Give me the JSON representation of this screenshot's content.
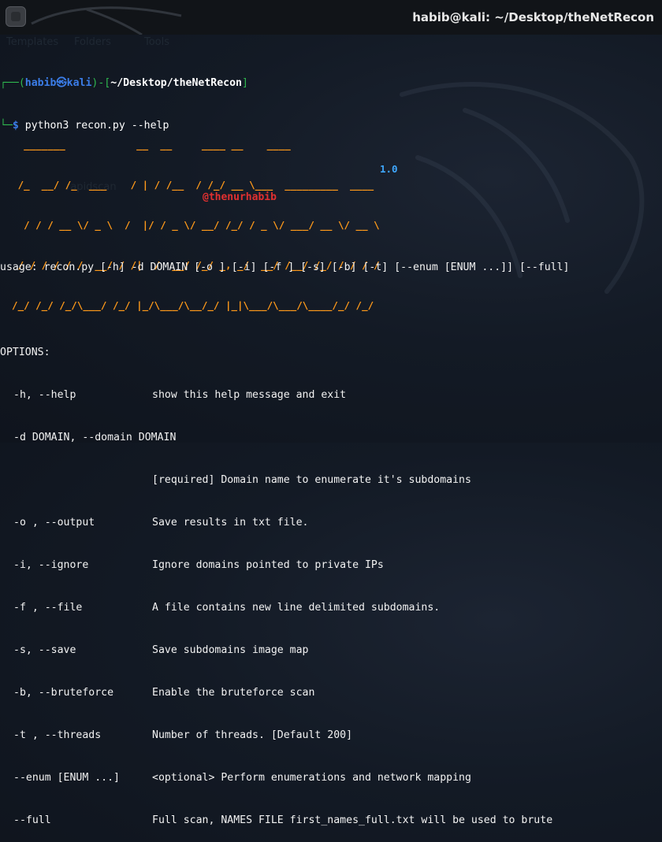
{
  "window": {
    "title": "habib@kali: ~/Desktop/theNetRecon"
  },
  "background": {
    "labels": [
      "Templates",
      "Folders",
      "Tools",
      "rapidscan"
    ]
  },
  "prompt": {
    "open": "┌──(",
    "user": "habib",
    "at_symbol": "㉿",
    "host": "kali",
    "mid": ")-[",
    "path": "~/Desktop/theNetRecon",
    "close": "]",
    "corner": "└─",
    "dollar": "$",
    "command": " python3 recon.py --help"
  },
  "banner": {
    "art": [
      "    _______            __  __     ____ __    ____",
      "   /_  __/ /_  ___    / | / /__  / /_/ __ \\___  _________  ____",
      "    / / / __ \\/ _ \\  /  |/ / _ \\/ __/ /_/ / _ \\/ ___/ __ \\/ __ \\",
      "   / / / / / /  __/ / /|  /  __/ /_/ _, _/  __/ /__/ /_/ / / / /",
      "  /_/ /_/ /_/\\___/ /_/ |_/\\___/\\__/_/ |_|\\___/\\___/\\____/_/ /_/"
    ],
    "version": "1.0",
    "handle": "@thenurhabib"
  },
  "help": {
    "usage": "usage: recon.py [-h] -d DOMAIN [-o ] [-i] [-f ] [-s] [-b] [-t] [--enum [ENUM ...]] [--full]",
    "options_header": "OPTIONS:",
    "options": [
      {
        "flag": "-h, --help",
        "desc": "show this help message and exit"
      },
      {
        "flag": "-d DOMAIN, --domain DOMAIN",
        "desc": ""
      },
      {
        "flag": "",
        "desc": "[required] Domain name to enumerate it's subdomains"
      },
      {
        "flag": "-o , --output",
        "desc": "Save results in txt file."
      },
      {
        "flag": "-i, --ignore",
        "desc": "Ignore domains pointed to private IPs"
      },
      {
        "flag": "-f , --file",
        "desc": "A file contains new line delimited subdomains."
      },
      {
        "flag": "-s, --save",
        "desc": "Save subdomains image map"
      },
      {
        "flag": "-b, --bruteforce",
        "desc": "Enable the bruteforce scan"
      },
      {
        "flag": "-t , --threads",
        "desc": "Number of threads. [Default 200]"
      },
      {
        "flag": "--enum [ENUM ...]",
        "desc": "<optional> Perform enumerations and network mapping"
      },
      {
        "flag": "--full",
        "desc": "Full scan, NAMES FILE first_names_full.txt will be used to brute"
      }
    ]
  },
  "colors": {
    "background": "#131a25",
    "titlebar": "#111418",
    "banner": "#ff9a1a",
    "version": "#3fa8ff",
    "handle": "#e03030",
    "prompt_blue": "#4c8ee8",
    "prompt_green": "#2fb84f"
  }
}
